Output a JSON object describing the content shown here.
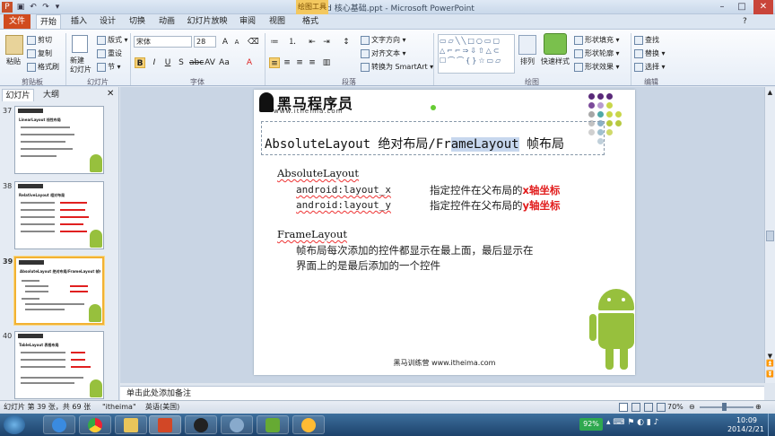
{
  "window": {
    "title": "Android 核心基础.ppt - Microsoft PowerPoint",
    "context_tab_group": "绘图工具"
  },
  "tabs": [
    "文件",
    "开始",
    "插入",
    "设计",
    "切换",
    "动画",
    "幻灯片放映",
    "审阅",
    "视图",
    "格式"
  ],
  "ribbon": {
    "clipboard": {
      "paste": "粘贴",
      "cut": "剪切",
      "copy": "复制",
      "format_painter": "格式刷",
      "label": "剪贴板"
    },
    "slides": {
      "new_slide": "新建\n幻灯片",
      "layout": "版式",
      "reset": "重设",
      "section": "节",
      "label": "幻灯片"
    },
    "font": {
      "font_name": "宋体",
      "font_size": "28",
      "label": "字体"
    },
    "paragraph": {
      "text_direction": "文字方向",
      "align_text": "对齐文本",
      "smartart": "转换为 SmartArt",
      "label": "段落"
    },
    "drawing": {
      "arrange": "排列",
      "quick_styles": "快速样式",
      "shape_fill": "形状填充",
      "shape_outline": "形状轮廓",
      "shape_effects": "形状效果",
      "label": "绘图"
    },
    "editing": {
      "find": "查找",
      "replace": "替换",
      "select": "选择",
      "label": "编辑"
    }
  },
  "left_pane": {
    "tabs": [
      "幻灯片",
      "大纲"
    ],
    "slides": [
      {
        "num": "37",
        "title": "LinearLayout 线性布局"
      },
      {
        "num": "38",
        "title": "RelativeLayout 相对布局"
      },
      {
        "num": "39",
        "title": "AbsoluteLayout 绝对布局/FrameLayout 帧布局"
      },
      {
        "num": "40",
        "title": "TableLayout 表格布局"
      }
    ]
  },
  "slide": {
    "brand": "黑马程序员",
    "url": "www.itheima.com",
    "title_a": "AbsoluteLayout 绝对布局/Fr",
    "title_hl": "ameLayout",
    "title_b": " 帧布局",
    "heading1": "AbsoluteLayout",
    "row1_code": "android:layout_x",
    "row1_text": "指定控件在父布局的",
    "row1_red": "x轴坐标",
    "row2_code": "android:layout_y",
    "row2_text": "指定控件在父布局的",
    "row2_red": "y轴坐标",
    "heading2": "FrameLayout",
    "para_line1": "帧布局每次添加的控件都显示在最上面，最后显示在",
    "para_line2": "界面上的是最后添加的一个控件",
    "footer": "黑马训练营 www.itheima.com"
  },
  "notes_placeholder": "单击此处添加备注",
  "status": {
    "slide_info": "幻灯片 第 39 张，共 69 张",
    "theme": "\"itheima\"",
    "language": "英语(美国)",
    "zoom": "70%"
  },
  "taskbar": {
    "battery": "92%",
    "time": "10:09",
    "date": "2014/2/21"
  },
  "colors": {
    "file_tab": "#d14b1e",
    "accent_red": "#e11b1b",
    "android_green": "#97c03d"
  }
}
